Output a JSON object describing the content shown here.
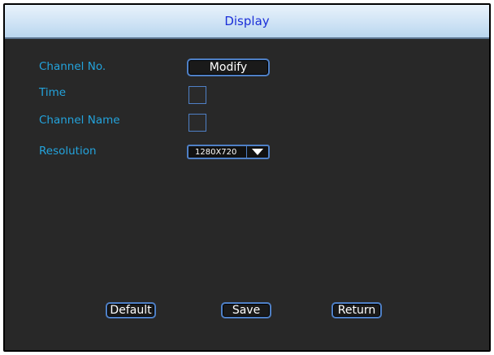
{
  "window": {
    "title": "Display"
  },
  "form": {
    "channel_no": {
      "label": "Channel No.",
      "button": "Modify"
    },
    "time": {
      "label": "Time"
    },
    "channel_name": {
      "label": "Channel Name"
    },
    "resolution": {
      "label": "Resolution",
      "value": "1280X720"
    }
  },
  "footer": {
    "default_label": "Default",
    "save_label": "Save",
    "return_label": "Return"
  },
  "colors": {
    "label": "#23a3dc",
    "title": "#1b2fd8",
    "border": "#4f80c6",
    "background": "#282828"
  },
  "icons": {
    "resolution_dropdown": "chevron-down-icon"
  }
}
